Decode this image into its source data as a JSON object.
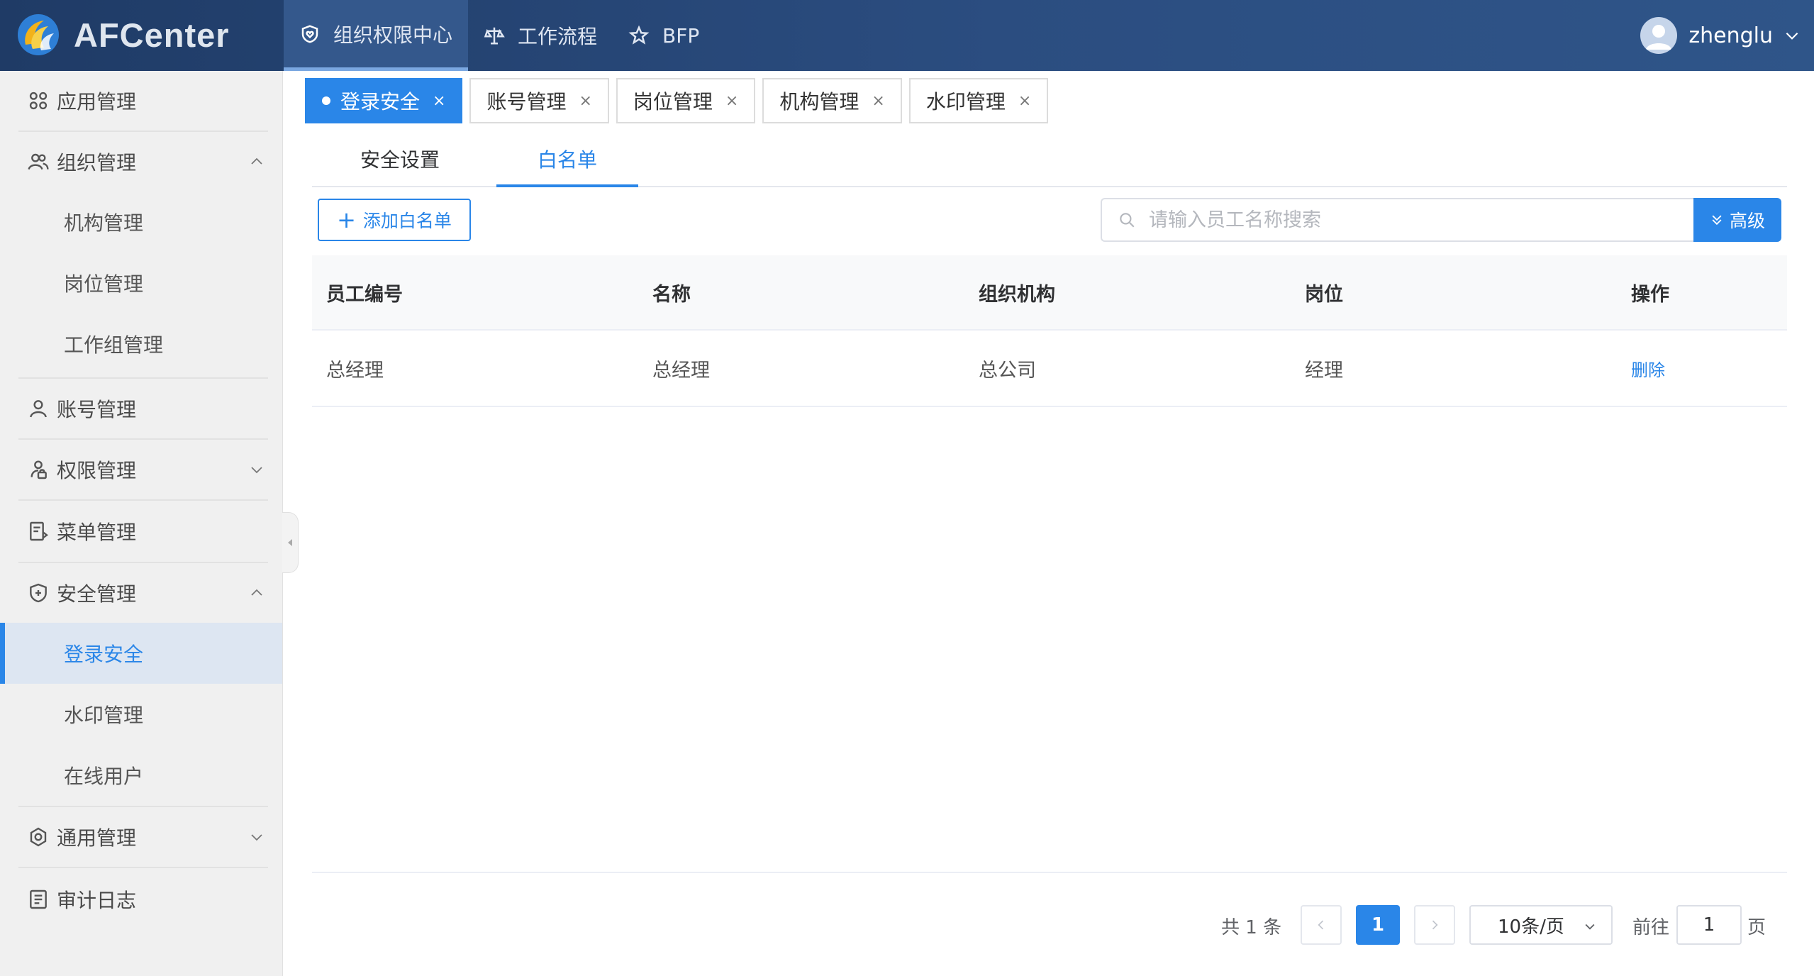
{
  "app": {
    "logo_text": "AFCenter"
  },
  "header": {
    "nav": [
      {
        "label": "组织权限中心",
        "icon": "shield-heart-icon",
        "active": true
      },
      {
        "label": "工作流程",
        "icon": "balance-scale-icon",
        "active": false
      },
      {
        "label": "BFP",
        "icon": "star-icon",
        "active": false
      }
    ],
    "user": {
      "name": "zhenglu"
    }
  },
  "sidebar": {
    "menu": [
      {
        "label": "应用管理",
        "icon": "grid-apps-icon"
      },
      {
        "label": "组织管理",
        "icon": "users-group-icon",
        "expanded": true
      },
      {
        "label": "机构管理"
      },
      {
        "label": "岗位管理"
      },
      {
        "label": "工作组管理"
      },
      {
        "label": "账号管理",
        "icon": "user-icon"
      },
      {
        "label": "权限管理",
        "icon": "user-lock-icon",
        "expanded": false
      },
      {
        "label": "菜单管理",
        "icon": "menu-doc-icon"
      },
      {
        "label": "安全管理",
        "icon": "shield-plus-icon",
        "expanded": true
      },
      {
        "label": "登录安全",
        "active": true
      },
      {
        "label": "水印管理"
      },
      {
        "label": "在线用户"
      },
      {
        "label": "通用管理",
        "icon": "settings-icon",
        "expanded": false
      },
      {
        "label": "审计日志",
        "icon": "log-doc-icon"
      }
    ]
  },
  "tags": [
    {
      "label": "登录安全",
      "active": true
    },
    {
      "label": "账号管理",
      "active": false
    },
    {
      "label": "岗位管理",
      "active": false
    },
    {
      "label": "机构管理",
      "active": false
    },
    {
      "label": "水印管理",
      "active": false
    }
  ],
  "tag_close_glyph": "×",
  "subtabs": [
    {
      "label": "安全设置",
      "active": false
    },
    {
      "label": "白名单",
      "active": true
    }
  ],
  "toolbar": {
    "add_label": "添加白名单",
    "add_glyph": "+",
    "search_placeholder": "请输入员工名称搜索",
    "advanced_label": "高级"
  },
  "table": {
    "columns": [
      "员工编号",
      "名称",
      "组织机构",
      "岗位",
      "操作"
    ],
    "rows": [
      {
        "cells": [
          "总经理",
          "总经理",
          "总公司",
          "经理"
        ],
        "action": "删除"
      }
    ]
  },
  "pagination": {
    "total_text": "共 1 条",
    "current_page": "1",
    "page_size": "10条/页",
    "goto_label": "前往",
    "goto_value": "1",
    "page_suffix": "页"
  },
  "colors": {
    "primary": "#2a86e8",
    "header_bg": "#2b4d80",
    "sidebar_bg": "#f0f0f0"
  }
}
